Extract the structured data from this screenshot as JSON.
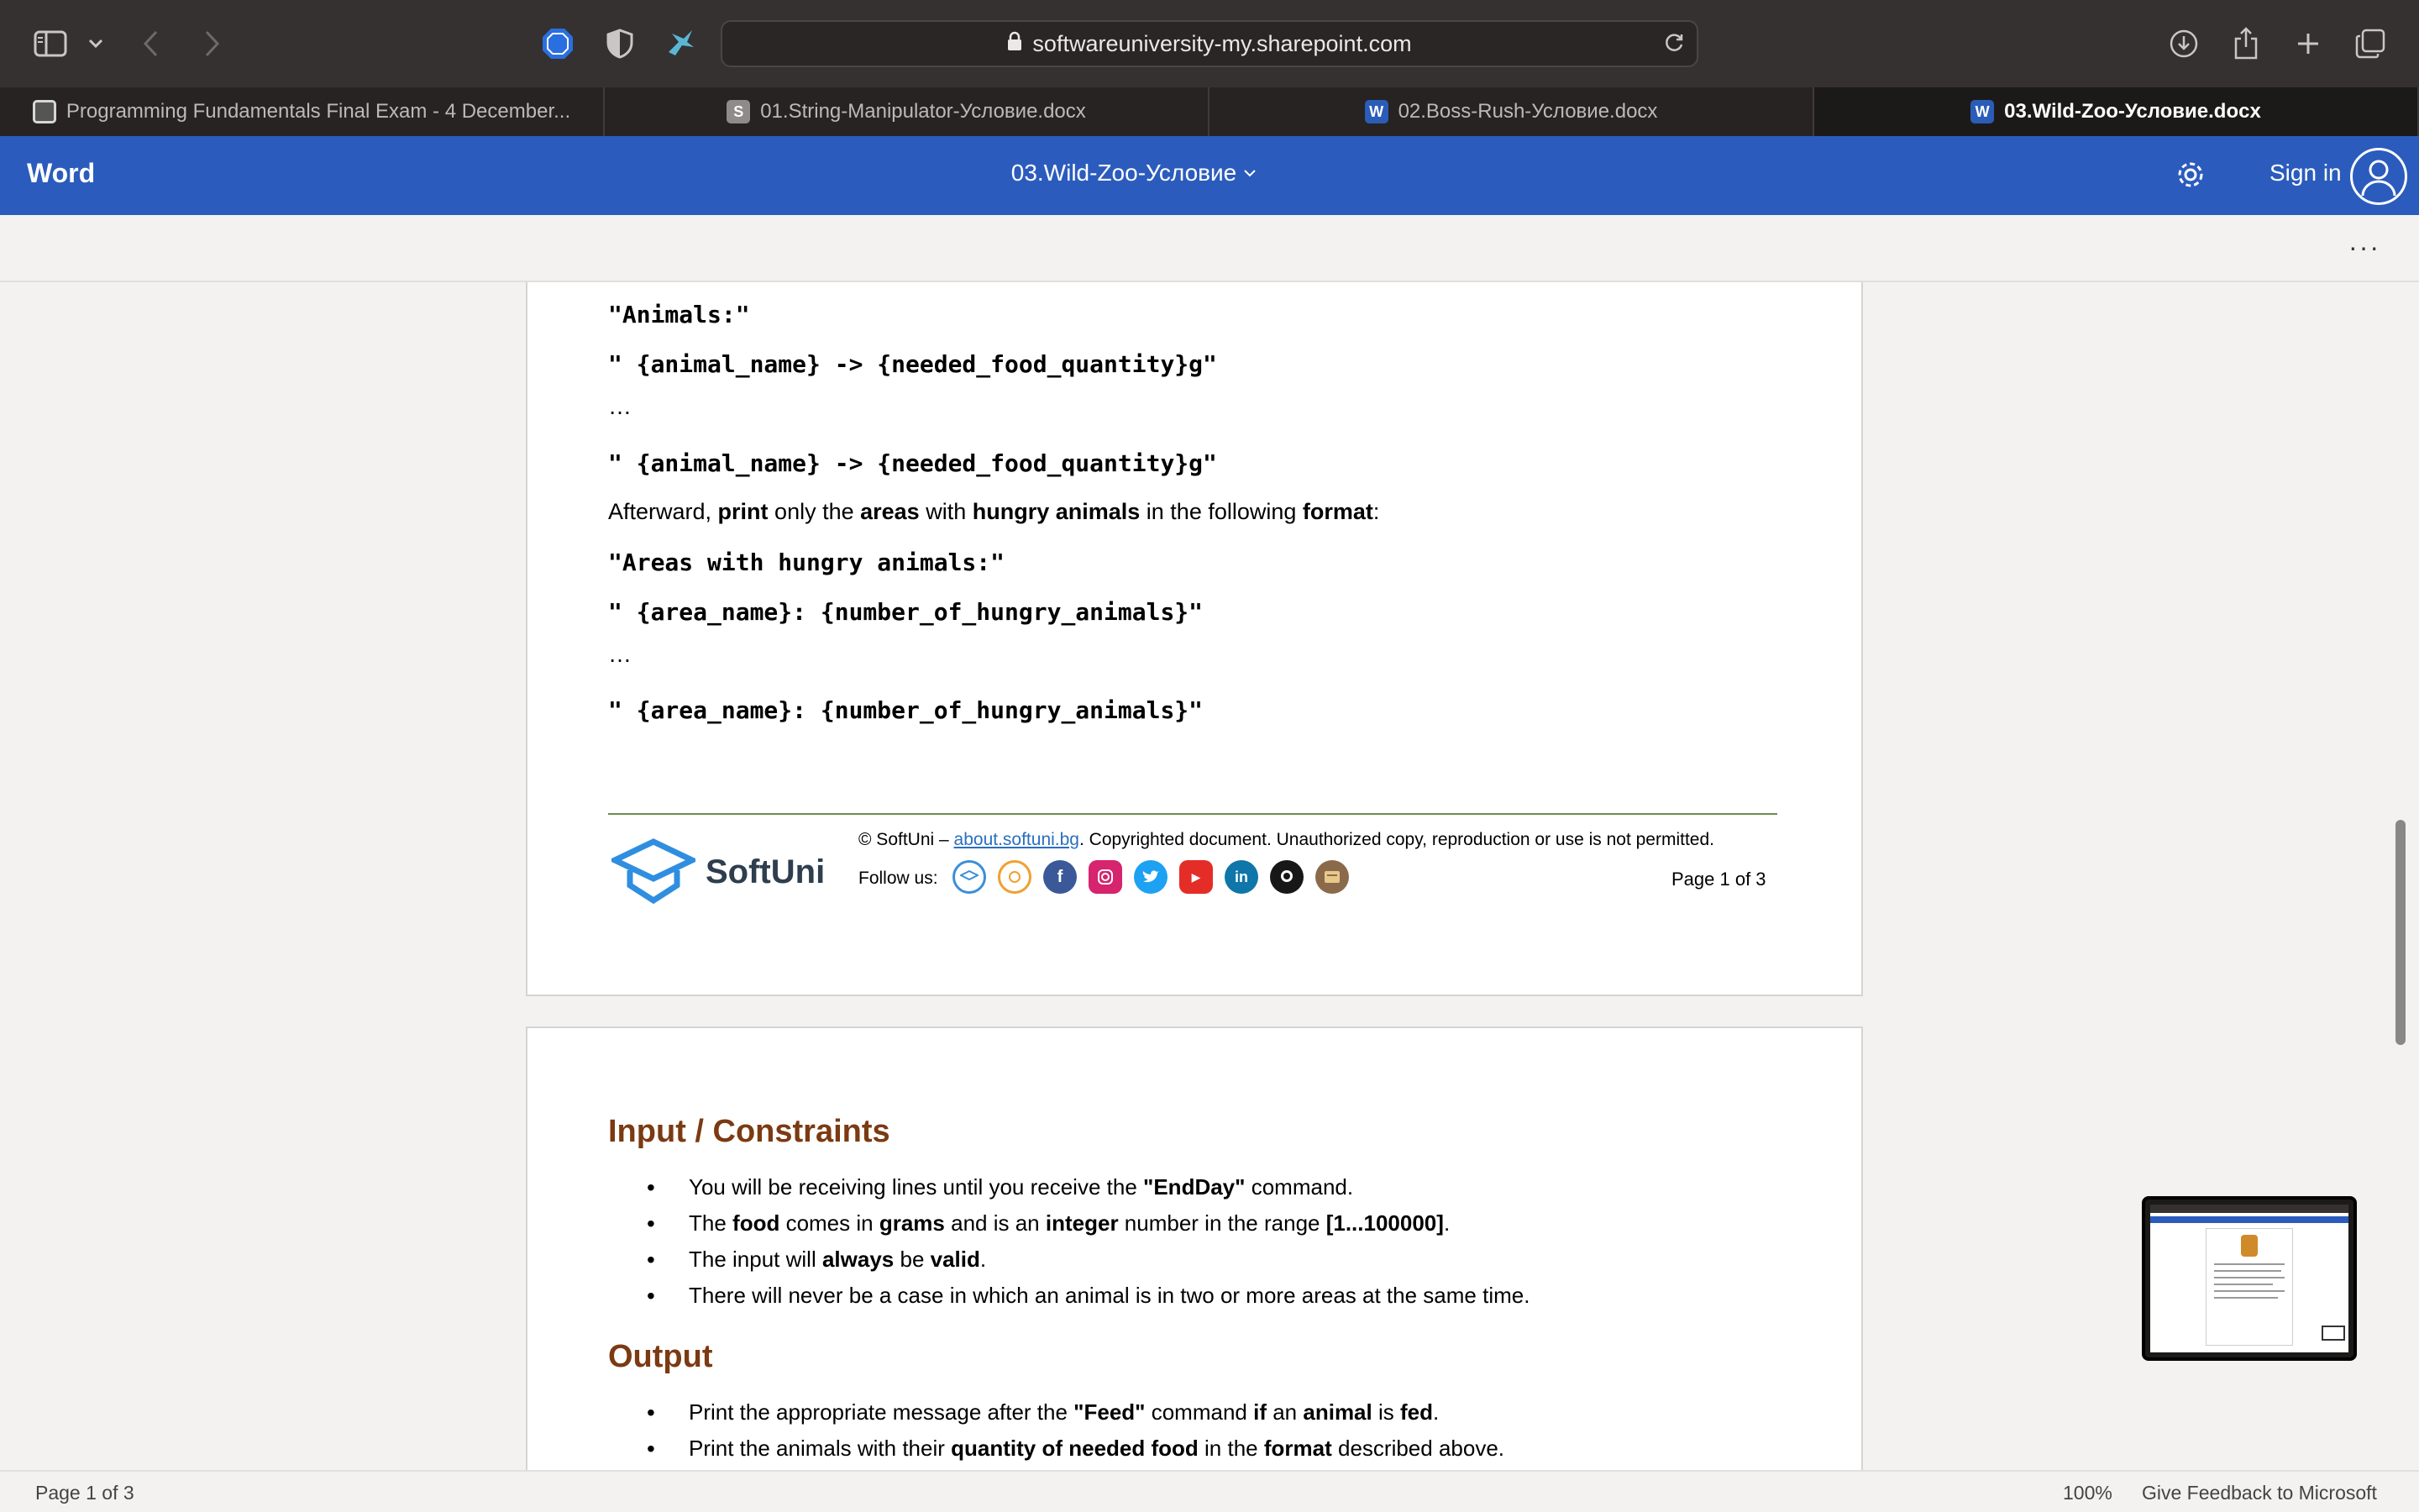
{
  "browser": {
    "url": "softwareuniversity-my.sharepoint.com",
    "tabs": [
      {
        "label": "Programming Fundamentals Final Exam - 4 December...",
        "icon": "screen-favicon"
      },
      {
        "label": "01.String-Manipulator-Условие.docx",
        "icon": "s-favicon",
        "badge": "S"
      },
      {
        "label": "02.Boss-Rush-Условие.docx",
        "icon": "word-favicon",
        "badge": "W"
      },
      {
        "label": "03.Wild-Zoo-Условие.docx",
        "icon": "word-favicon",
        "badge": "W"
      }
    ]
  },
  "word": {
    "app_name": "Word",
    "doc_title": "03.Wild-Zoo-Условие",
    "sign_in": "Sign in",
    "more": "···"
  },
  "page1": {
    "code1": "\"Animals:\"",
    "code2": "\" {animal_name} -> {needed_food_quantity}g\"",
    "ellipsis": "…",
    "code3": "\" {animal_name} -> {needed_food_quantity}g\"",
    "afterward": {
      "t1": "Afterward, ",
      "b1": "print",
      "t2": " only the ",
      "b2": "areas",
      "t3": " with ",
      "b3": "hungry animals",
      "t4": " in the following ",
      "b4": "format",
      "t5": ":"
    },
    "code4": "\"Areas with hungry animals:\"",
    "code5": "\" {area_name}: {number_of_hungry_animals}\"",
    "code6": "\" {area_name}: {number_of_hungry_animals}\""
  },
  "footer": {
    "logo_text": "SoftUni",
    "copyright_prefix": "© SoftUni – ",
    "copyright_link": "about.softuni.bg",
    "copyright_suffix": ". Copyrighted document. Unauthorized copy, reproduction or use is not permitted.",
    "follow": "Follow us:",
    "page": "Page 1 of 3"
  },
  "page2": {
    "input_heading": "Input / Constraints",
    "input_items": [
      {
        "t1": "You will be receiving lines until you receive the ",
        "b1": "\"EndDay\"",
        "t2": " command."
      },
      {
        "t1": "The ",
        "b1": "food",
        "t2": " comes in ",
        "b2": "grams",
        "t3": " and is an ",
        "b3": "integer",
        "t4": " number in the range ",
        "b4": "[1...100000]",
        "t5": "."
      },
      {
        "t1": "The input will ",
        "b1": "always",
        "t2": " be ",
        "b2": "valid",
        "t3": "."
      },
      {
        "t1": "There will never be a case in which an animal is in two or more areas at the same time."
      }
    ],
    "output_heading": "Output",
    "output_items": [
      {
        "t1": "Print the appropriate message after the ",
        "b1": "\"Feed\"",
        "t2": " command ",
        "b2": "if",
        "t3": " an ",
        "b3": "animal",
        "t4": " is ",
        "b4": "fed",
        "t5": "."
      },
      {
        "t1": "Print the animals with their ",
        "b1": "quantity of needed food",
        "t2": " in the ",
        "b2": "format",
        "t3": " described above."
      }
    ]
  },
  "status": {
    "page": "Page 1 of 3",
    "zoom": "100%",
    "feedback": "Give Feedback to Microsoft"
  },
  "colors": {
    "word_blue": "#2b5cbd",
    "heading_brown": "#7b3a12",
    "footer_rule": "#6b8e4e"
  }
}
